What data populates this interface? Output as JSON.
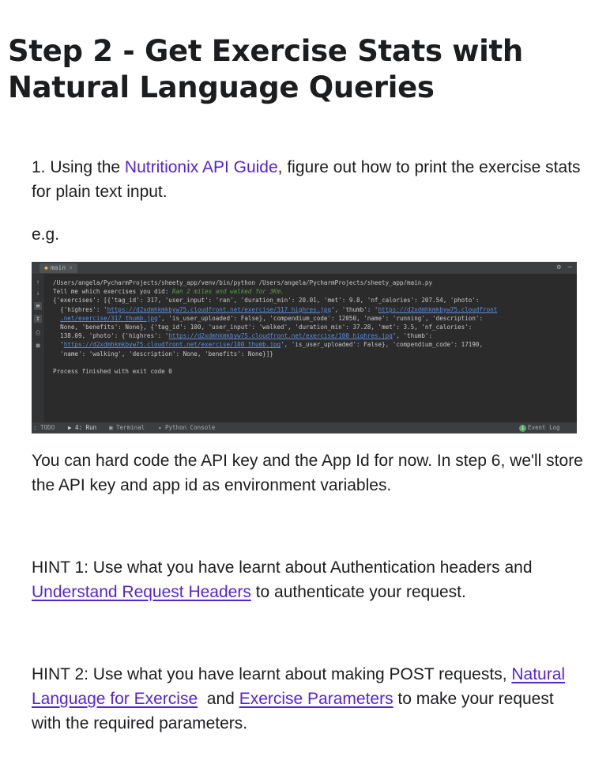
{
  "heading": "Step 2 - Get Exercise Stats with Natural Language Queries",
  "step1": {
    "prefix": "1. Using the ",
    "link": "Nutritionix API Guide",
    "suffix": ", figure out how to print the exercise stats for plain text input."
  },
  "eg": "e.g.",
  "ide": {
    "tab_label": "main",
    "lines": [
      {
        "parts": [
          {
            "t": "/Users/angela/PycharmProjects/sheety_app/venv/bin/python /Users/angela/PycharmProjects/sheety_app/main.py"
          }
        ]
      },
      {
        "parts": [
          {
            "t": "Tell me which exercises you did: "
          },
          {
            "t": "Ran 2 miles and walked for 3Km.",
            "s": "green"
          }
        ]
      },
      {
        "parts": [
          {
            "t": "{'exercises': [{'tag_id': 317, 'user_input': 'ran', 'duration_min': 20.01, 'met': 9.8, 'nf_calories': 207.54, 'photo':"
          }
        ]
      },
      {
        "parts": [
          {
            "t": "  {'highres': '"
          },
          {
            "t": "https://d2xdmhkmkbyw75.cloudfront.net/exercise/317_highres.jpg",
            "s": "url"
          },
          {
            "t": "', 'thumb': '"
          },
          {
            "t": "https://d2xdmhkmkbyw75.cloudfront",
            "s": "url"
          }
        ]
      },
      {
        "parts": [
          {
            "t": "  "
          },
          {
            "t": ".net/exercise/317_thumb.jpg",
            "s": "url"
          },
          {
            "t": "', 'is_user_uploaded': False}, 'compendium_code': 12050, 'name': 'running', 'description':"
          }
        ]
      },
      {
        "parts": [
          {
            "t": "  None, 'benefits': None}, {'tag_id': 100, 'user_input': 'walked', 'duration_min': 37.28, 'met': 3.5, 'nf_calories':"
          }
        ]
      },
      {
        "parts": [
          {
            "t": "  138.09, 'photo': {'highres': '"
          },
          {
            "t": "https://d2xdmhkmkbyw75.cloudfront.net/exercise/100_highres.jpg",
            "s": "url"
          },
          {
            "t": "', 'thumb':"
          }
        ]
      },
      {
        "parts": [
          {
            "t": "  '"
          },
          {
            "t": "https://d2xdmhkmkbyw75.cloudfront.net/exercise/100_thumb.jpg",
            "s": "url"
          },
          {
            "t": "', 'is_user_uploaded': False}, 'compendium_code': 17190,"
          }
        ]
      },
      {
        "parts": [
          {
            "t": "  'name': 'walking', 'description': None, 'benefits': None}]}"
          }
        ]
      },
      {
        "parts": [
          {
            "t": ""
          }
        ]
      },
      {
        "parts": [
          {
            "t": "Process finished with exit code 0"
          }
        ]
      }
    ],
    "bottom": {
      "todo": ": TODO",
      "run": "4: Run",
      "terminal": "Terminal",
      "python_console": "Python Console",
      "event_badge": "1",
      "event_log": "Event Log"
    }
  },
  "para_api_key": "You can hard code the API key and the App Id for now. In step 6, we'll store the API key and app id as environment variables.",
  "hint1": {
    "prefix": "HINT 1:  Use what you have learnt about Authentication headers and ",
    "link": "Understand Request Headers",
    "suffix": " to authenticate your request."
  },
  "hint2": {
    "prefix": "HINT 2: Use what you have learnt about making POST requests, ",
    "link1": "Natural Language for Exercise",
    "middle": "  and ",
    "link2": "Exercise Parameters",
    "suffix": " to make your request with the required parameters."
  }
}
